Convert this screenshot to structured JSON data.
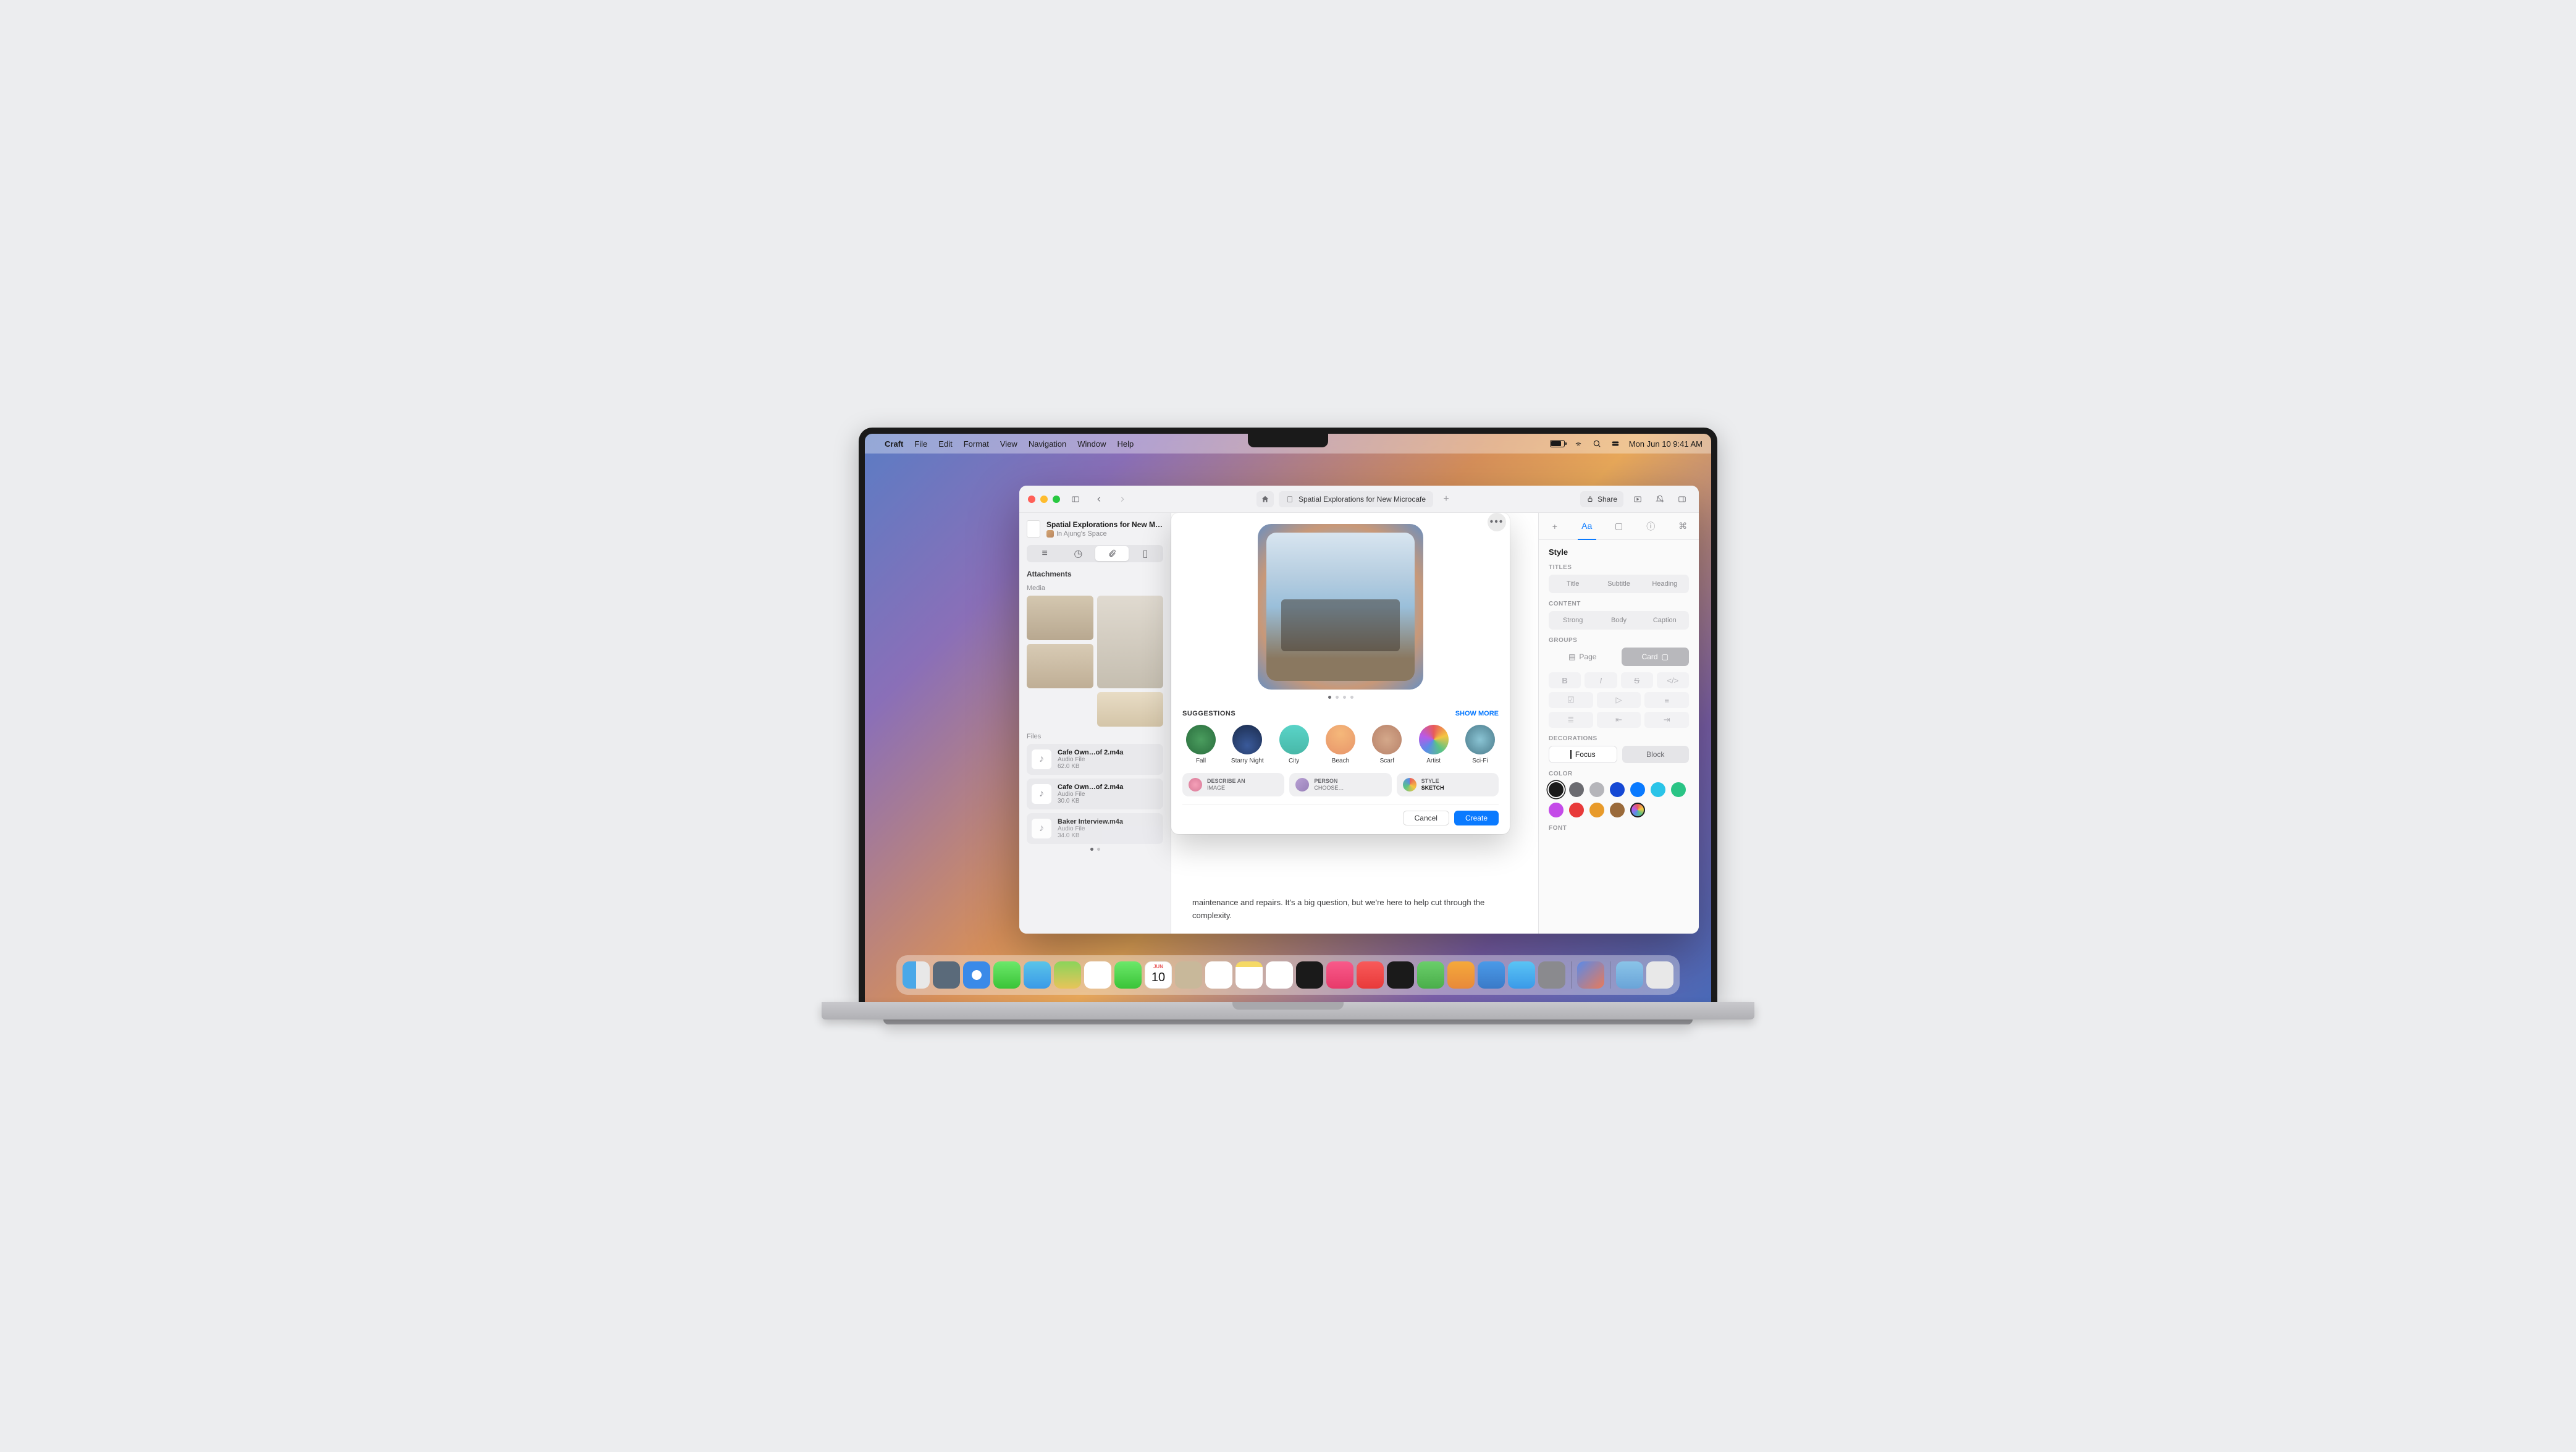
{
  "menubar": {
    "appname": "Craft",
    "items": [
      "File",
      "Edit",
      "Format",
      "View",
      "Navigation",
      "Window",
      "Help"
    ],
    "datetime": "Mon Jun 10  9:41 AM"
  },
  "window": {
    "doc_title_chip": "Spatial Explorations for New Microcafe",
    "share": "Share"
  },
  "sidebar": {
    "doc_title": "Spatial Explorations for New Micr…",
    "space": "In Ajung's Space",
    "attachments": "Attachments",
    "media": "Media",
    "files_label": "Files",
    "files": [
      {
        "name": "Cafe Own…of 2.m4a",
        "type": "Audio File",
        "size": "62.0 KB"
      },
      {
        "name": "Cafe Own…of 2.m4a",
        "type": "Audio File",
        "size": "30.0 KB"
      },
      {
        "name": "Baker Interview.m4a",
        "type": "Audio File",
        "size": "34.0 KB"
      }
    ]
  },
  "canvas": {
    "body_excerpt": "maintenance and repairs. It's a big question, but we're here to help cut through the complexity."
  },
  "popover": {
    "suggestions_title": "SUGGESTIONS",
    "show_more": "SHOW MORE",
    "suggestions": [
      "Fall",
      "Starry Night",
      "City",
      "Beach",
      "Scarf",
      "Artist",
      "Sci-Fi"
    ],
    "action_describe": {
      "label": "DESCRIBE AN",
      "sub": "IMAGE"
    },
    "action_person": {
      "label": "PERSON",
      "sub": "CHOOSE…"
    },
    "action_style": {
      "label": "STYLE",
      "sub": "SKETCH"
    },
    "cancel": "Cancel",
    "create": "Create"
  },
  "inspector": {
    "style": "Style",
    "titles": "TITLES",
    "title_opts": [
      "Title",
      "Subtitle",
      "Heading"
    ],
    "content": "CONTENT",
    "content_opts": [
      "Strong",
      "Body",
      "Caption"
    ],
    "groups": "GROUPS",
    "page": "Page",
    "card": "Card",
    "decorations": "DECORATIONS",
    "focus": "Focus",
    "block": "Block",
    "color": "COLOR",
    "colors": [
      "#1a1a1a",
      "#6b6b70",
      "#b5b5ba",
      "#1548d4",
      "#0a7aff",
      "#2ac4e8",
      "#2ac485",
      "#c44ae8",
      "#e83a3a",
      "#e89a2a",
      "#9a6a3a",
      "rainbow"
    ],
    "selected_color": 0,
    "font": "FONT"
  },
  "dock": {
    "cal_month": "JUN",
    "cal_day": "10",
    "icons": [
      "finder",
      "launchpad",
      "safari",
      "messages",
      "mail",
      "maps",
      "photos",
      "facetime",
      "calendar",
      "contacts",
      "reminders",
      "notes",
      "freeform",
      "tv",
      "music",
      "news",
      "stocks",
      "numbers",
      "pages",
      "keynote",
      "appstore",
      "settings",
      "craft",
      "downloads",
      "trash"
    ]
  }
}
